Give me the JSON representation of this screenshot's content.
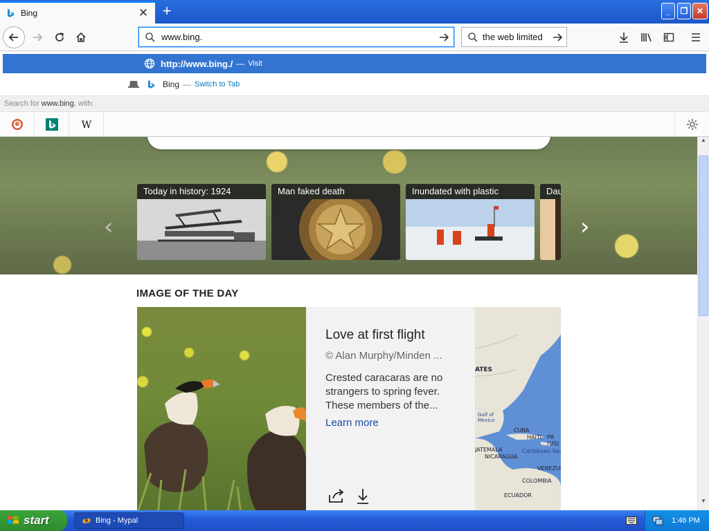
{
  "browser": {
    "tab": {
      "title": "Bing"
    },
    "url": "www.bing.",
    "search_box": "the web limited"
  },
  "autocomplete": {
    "row1": {
      "url": "http://www.bing./",
      "separator": "—",
      "action": "Visit"
    },
    "row2": {
      "title": "Bing",
      "separator": "—",
      "action": "Switch to Tab"
    },
    "oneoff_header": {
      "prefix": "Search for",
      "query": "www.bing.",
      "suffix": "with:"
    },
    "engines": [
      "duckduckgo-icon",
      "bing-icon",
      "wikipedia-icon"
    ]
  },
  "page": {
    "cards": [
      {
        "title": "Today in history: 1924"
      },
      {
        "title": "Man faked death"
      },
      {
        "title": "Inundated with plastic"
      },
      {
        "title": "Dau"
      }
    ],
    "iotd": {
      "section_label": "IMAGE OF THE DAY",
      "title": "Love at first flight",
      "credit": "© Alan Murphy/Minden ...",
      "description": "Crested caracaras are no strangers to spring fever. These members of the...",
      "learn_more": "Learn more",
      "map_labels": [
        "ATES",
        "Gulf of Mexico",
        "CUBA",
        "HAITI",
        "PR (US)",
        "JATEMALA",
        "NICARAGUA",
        "Caribbean Sea",
        "VENEZUE",
        "COLOMBIA",
        "ECUADOR"
      ]
    }
  },
  "taskbar": {
    "start_label": "start",
    "task_label": "Bing - Mypal",
    "clock": "1:46 PM"
  },
  "colors": {
    "accent": "#3374d1",
    "taskbar": "#245ddb",
    "start": "#3ba43a"
  }
}
